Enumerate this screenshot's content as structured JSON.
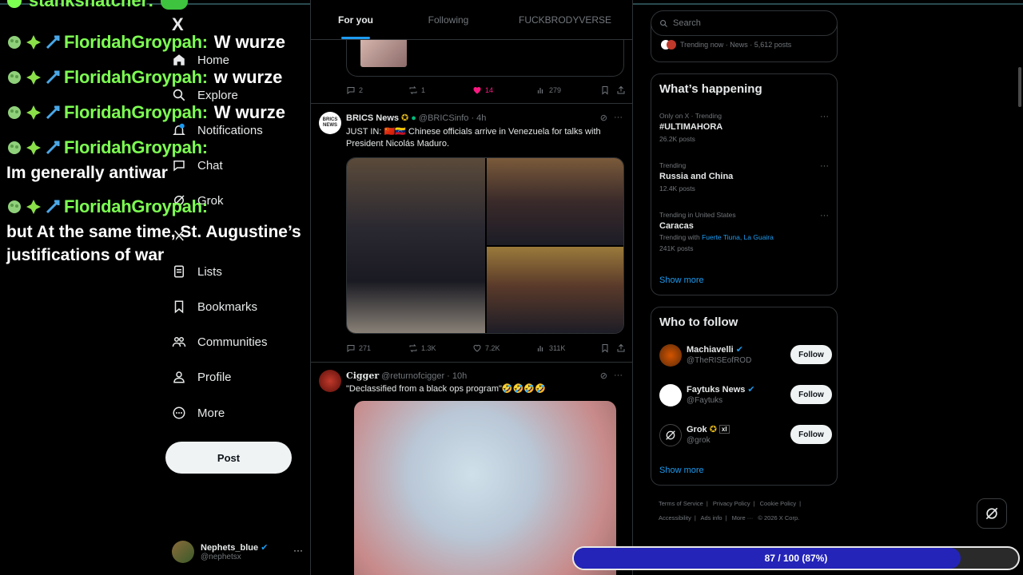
{
  "chat": {
    "top_name": "stankshatcher:",
    "messages": [
      {
        "user": "FloridahGroypah:",
        "text": "W wurze"
      },
      {
        "user": "FloridahGroypah:",
        "text": "w wurze"
      },
      {
        "user": "FloridahGroypah:",
        "text": "W wurze"
      },
      {
        "user": "FloridahGroypah:",
        "text": ""
      },
      {
        "user": "FloridahGroypah:",
        "text": ""
      }
    ],
    "lines": [
      "Im generally antiwar",
      "but At the same time, St. Augustine’s",
      "justifications of war"
    ]
  },
  "nav": {
    "logo": "X",
    "items": [
      {
        "label": "Home",
        "icon": "home-icon"
      },
      {
        "label": "Explore",
        "icon": "search-icon"
      },
      {
        "label": "Notifications",
        "icon": "bell-icon"
      },
      {
        "label": "Chat",
        "icon": "chat-icon"
      },
      {
        "label": "Grok",
        "icon": "grok-icon"
      },
      {
        "label": "",
        "icon": "x-icon"
      },
      {
        "label": "Lists",
        "icon": "list-icon"
      },
      {
        "label": "Bookmarks",
        "icon": "bookmark-icon"
      },
      {
        "label": "Communities",
        "icon": "communities-icon"
      },
      {
        "label": "Profile",
        "icon": "profile-icon"
      },
      {
        "label": "More",
        "icon": "more-circle-icon"
      }
    ],
    "post_label": "Post",
    "account": {
      "name": "Nephets_blue",
      "handle": "@nephetsx",
      "more": "···"
    }
  },
  "feed": {
    "tabs": [
      {
        "label": "For you",
        "active": true
      },
      {
        "label": "Following",
        "active": false
      },
      {
        "label": "FUCKBRODYVERSE",
        "active": false
      }
    ],
    "prev_tweet_actions": {
      "replies": "2",
      "reposts": "1",
      "likes": "14",
      "views": "279"
    },
    "tweets": [
      {
        "name": "BRICS News",
        "handle": "@BRICSinfo",
        "time": "· 4h",
        "avatar_text": "BRICS NEWS",
        "text": "JUST IN: 🇨🇳🇻🇪 Chinese officials arrive in Venezuela for talks with President Nicolás Maduro.",
        "actions": {
          "replies": "271",
          "reposts": "1.3K",
          "likes": "7.2K",
          "views": "311K"
        }
      },
      {
        "name": "Cigger",
        "handle": "@returnofcigger",
        "time": "· 10h",
        "text": "\"Declassified from a black ops program\"🤣🤣🤣🤣"
      }
    ]
  },
  "right": {
    "search_placeholder": "Search",
    "trending_now": "Trending now · News · 5,612 posts",
    "whats_happening": {
      "title": "What’s happening",
      "trends": [
        {
          "context": "Only on X · Trending",
          "title": "#ULTIMAHORA",
          "count": "26.2K posts"
        },
        {
          "context": "Trending",
          "title": "Russia and China",
          "count": "12.4K posts"
        },
        {
          "context": "Trending in United States",
          "title": "Caracas",
          "with_prefix": "Trending with",
          "with_links": "Fuerte Tiuna, La Guaira",
          "count": "241K posts"
        }
      ],
      "show_more": "Show more"
    },
    "who_to_follow": {
      "title": "Who to follow",
      "accounts": [
        {
          "name": "Machiavelli",
          "handle": "@TheRISEofROD",
          "button": "Follow"
        },
        {
          "name": "Faytuks News",
          "handle": "@Faytuks",
          "button": "Follow"
        },
        {
          "name": "Grok",
          "handle": "@grok",
          "button": "Follow"
        }
      ],
      "show_more": "Show more"
    },
    "footer": [
      "Terms of Service",
      "|",
      "Privacy Policy",
      "|",
      "Cookie Policy",
      "|",
      "Accessibility",
      "|",
      "Ads info",
      "|",
      "More ···",
      "© 2026 X Corp."
    ]
  },
  "progress": {
    "text": "87 / 100 (87%)",
    "value": 0.87
  },
  "colors": {
    "accent": "#1d9bf0",
    "chat_name": "#7dff52",
    "progress_fill": "#2424b8",
    "like_pink": "#f91880"
  }
}
